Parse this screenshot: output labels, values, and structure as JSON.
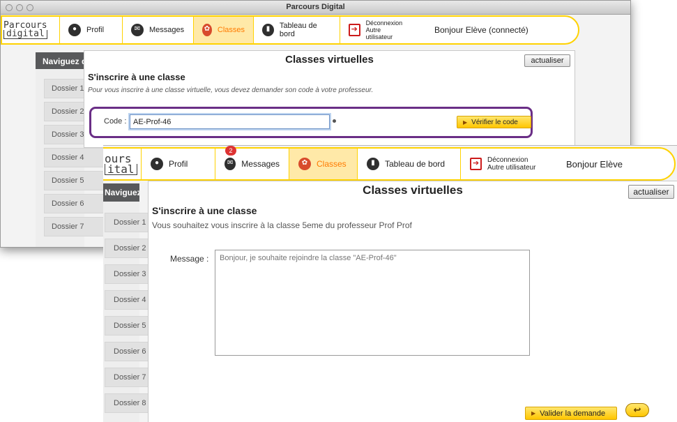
{
  "window1": {
    "title": "Parcours Digital",
    "logo": {
      "line1": "Parcours",
      "line2": "digital"
    },
    "nav": {
      "profil": "Profil",
      "messages": "Messages",
      "classes": "Classes",
      "tableau": "Tableau de bord",
      "deconnexion": "Déconnexion",
      "autre": "Autre utilisateur"
    },
    "greeting": "Bonjour Elève (connecté)",
    "sidebar_title": "Naviguez dans vos dossiers",
    "folders": [
      "Dossier 1",
      "Dossier 2",
      "Dossier 3",
      "Dossier 4",
      "Dossier 5",
      "Dossier 6",
      "Dossier 7"
    ],
    "panel_title": "Classes virtuelles",
    "refresh_label": "actualiser",
    "section_title": "S'inscrire à une classe",
    "instruction": "Pour vous inscrire à une classe virtuelle, vous devez demander son code à votre professeur.",
    "code_label": "Code :",
    "code_value": "AE-Prof-46",
    "verify_label": "Vérifier le code"
  },
  "window2": {
    "logo": {
      "line1": "ours",
      "line2": "ital"
    },
    "nav": {
      "profil": "Profil",
      "messages": "Messages",
      "messages_badge": "2",
      "classes": "Classes",
      "tableau": "Tableau de bord",
      "deconnexion": "Déconnexion",
      "autre": "Autre utilisateur"
    },
    "greeting": "Bonjour Elève",
    "sidebar_title": "Naviguez dans vos dossiers",
    "folders": [
      "Dossier 1",
      "Dossier 2",
      "Dossier 3",
      "Dossier 4",
      "Dossier 5",
      "Dossier 6",
      "Dossier 7",
      "Dossier 8"
    ],
    "panel_title": "Classes virtuelles",
    "refresh_label": "actualiser",
    "section_title": "S'inscrire à une classe",
    "info": "Vous souhaitez vous inscrire à la classe 5eme du professeur Prof Prof",
    "message_label": "Message :",
    "message_placeholder": "Bonjour, je souhaite rejoindre la classe \"AE-Prof-46\"",
    "submit_label": "Valider la demande",
    "back_glyph": "↩"
  },
  "colors": {
    "accent_yellow": "#ffd200",
    "highlight_purple": "#6a2e86",
    "sidebar_gray": "#58595b"
  }
}
